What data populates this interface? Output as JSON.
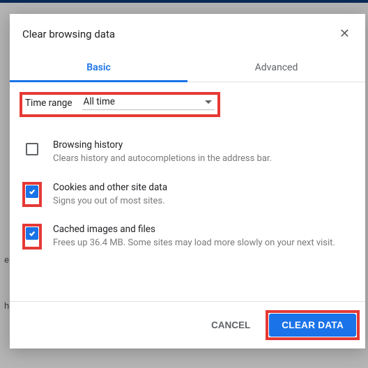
{
  "dialog": {
    "title": "Clear browsing data",
    "tabs": {
      "basic": "Basic",
      "advanced": "Advanced"
    }
  },
  "timeRange": {
    "label": "Time range",
    "value": "All time"
  },
  "options": {
    "history": {
      "title": "Browsing history",
      "sub": "Clears history and autocompletions in the address bar.",
      "checked": false
    },
    "cookies": {
      "title": "Cookies and other site data",
      "sub": "Signs you out of most sites.",
      "checked": true
    },
    "cache": {
      "title": "Cached images and files",
      "sub": "Frees up 36.4 MB. Some sites may load more slowly on your next visit.",
      "checked": true
    }
  },
  "footer": {
    "cancel": "CANCEL",
    "clear": "CLEAR DATA"
  }
}
